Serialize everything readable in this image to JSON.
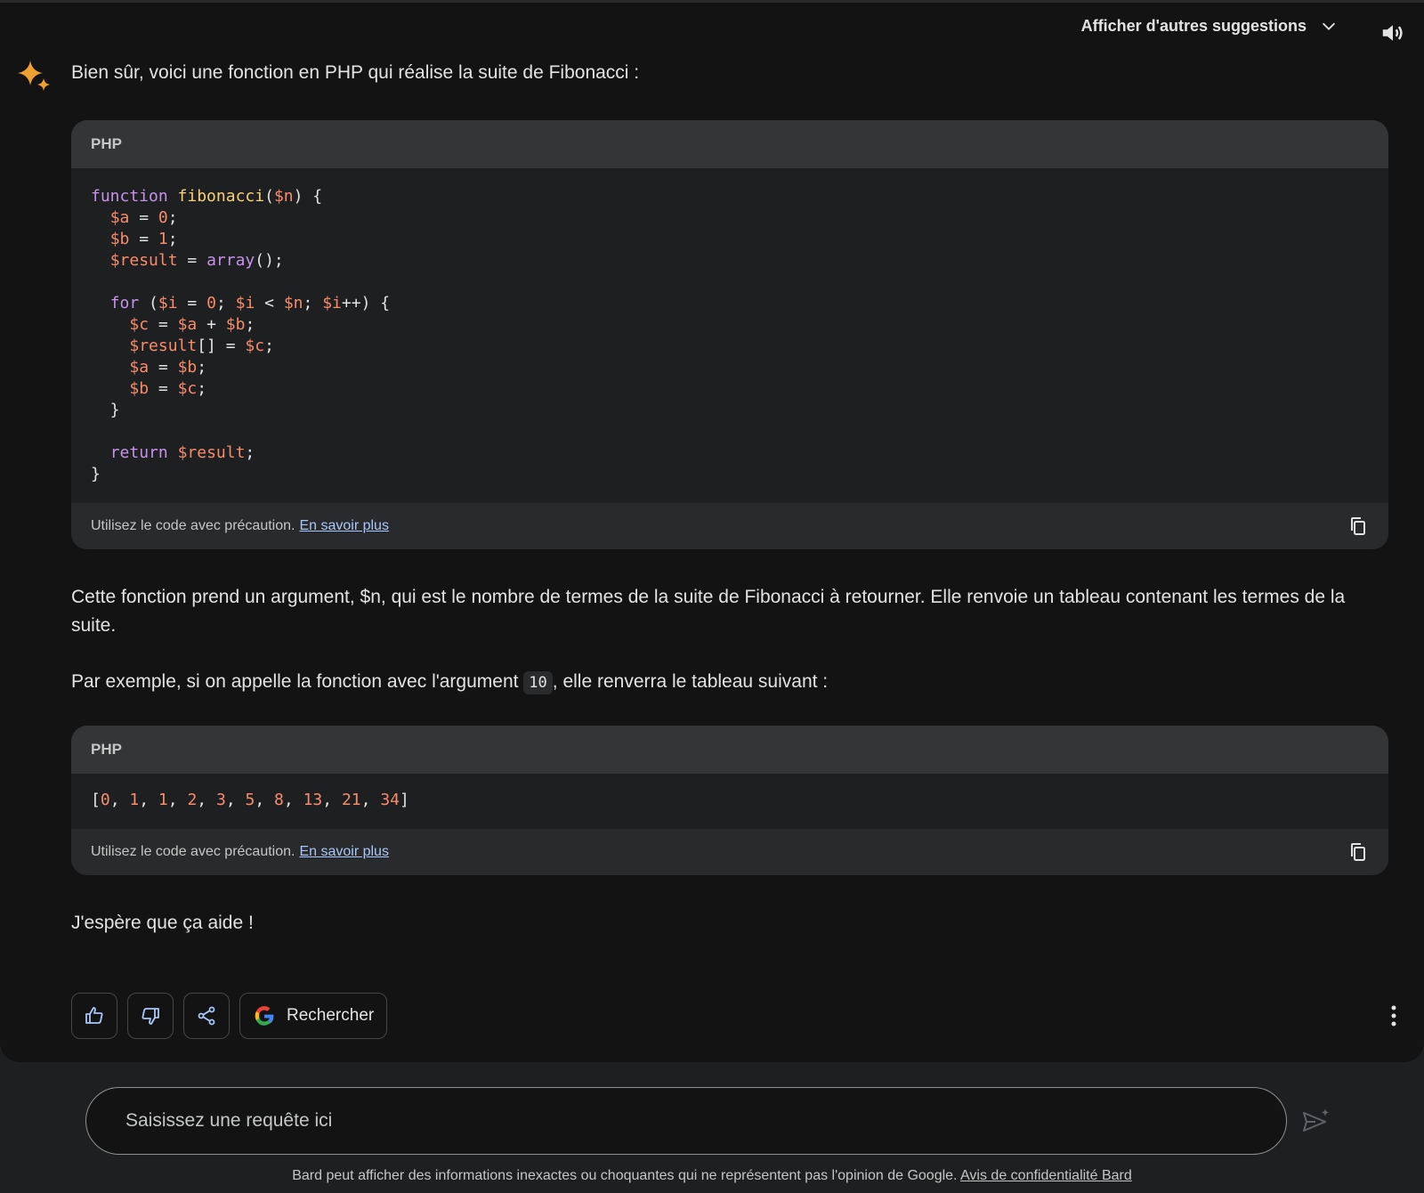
{
  "header": {
    "suggestions_label": "Afficher d'autres suggestions"
  },
  "response": {
    "intro": "Bien sûr, voici une fonction en PHP qui réalise la suite de Fibonacci :",
    "code_blocks": [
      {
        "language": "PHP",
        "caution": "Utilisez le code avec précaution.",
        "learn_more": "En savoir plus"
      },
      {
        "language": "PHP",
        "caution": "Utilisez le code avec précaution.",
        "learn_more": "En savoir plus",
        "output": [
          "0",
          "1",
          "1",
          "2",
          "3",
          "5",
          "8",
          "13",
          "21",
          "34"
        ]
      }
    ],
    "explanation": "Cette fonction prend un argument, $n, qui est le nombre de termes de la suite de Fibonacci à retourner. Elle renvoie un tableau contenant les termes de la suite.",
    "example_before": "Par exemple, si on appelle la fonction avec l'argument ",
    "example_code": "10",
    "example_after": ", elle renverra le tableau suivant :",
    "closing": "J'espère que ça aide !"
  },
  "actions": {
    "search_label": "Rechercher"
  },
  "input": {
    "placeholder": "Saisissez une requête ici"
  },
  "footer": {
    "disclaimer": "Bard peut afficher des informations inexactes ou choquantes qui ne représentent pas l'opinion de Google.",
    "privacy_link": "Avis de confidentialité Bard"
  },
  "colors": {
    "background": "#131314",
    "code_header": "#343536",
    "link": "#a8c7fa",
    "keyword": "#c792ea",
    "function": "#f7d07a",
    "variable": "#f78c6c"
  }
}
